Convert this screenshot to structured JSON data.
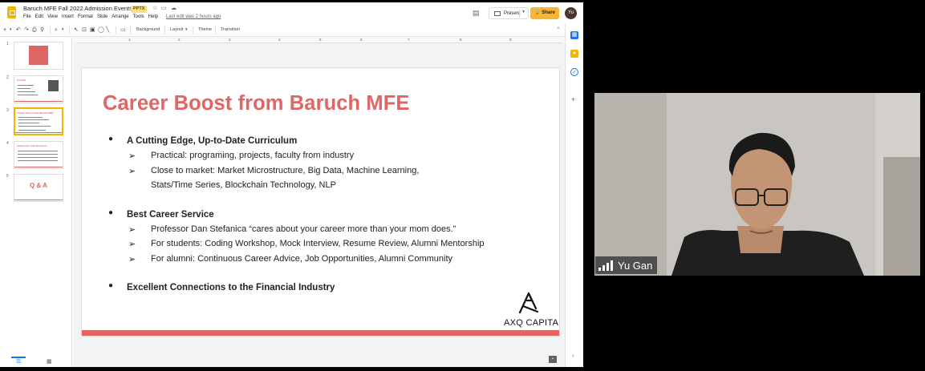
{
  "window": {
    "doc_title": "Baruch MFE Fall 2022 Admission Events",
    "format_badge": "PPTX",
    "menu": [
      "File",
      "Edit",
      "View",
      "Insert",
      "Format",
      "Slide",
      "Arrange",
      "Tools",
      "Help"
    ],
    "last_edit": "Last edit was 2 hours ago",
    "present_label": "Present",
    "share_label": "Share",
    "avatar_initials": "Yu"
  },
  "toolbar": {
    "background_label": "Background",
    "layout_label": "Layout",
    "theme_label": "Theme",
    "transition_label": "Transition"
  },
  "ruler": [
    "1",
    "2",
    "3",
    "4",
    "5",
    "6",
    "7",
    "8",
    "9"
  ],
  "filmstrip": {
    "slides": [
      {
        "number": "1",
        "title": "",
        "active": false
      },
      {
        "number": "2",
        "title": "Content",
        "active": false
      },
      {
        "number": "3",
        "title": "Career Boost from Baruch MFE",
        "active": true
      },
      {
        "number": "4",
        "title": "Admission / Info Sessions",
        "active": false
      },
      {
        "number": "5",
        "title": "Q & A",
        "active": false
      }
    ]
  },
  "slide": {
    "title": "Career Boost from Baruch MFE",
    "sections": [
      {
        "heading": "A  Cutting Edge, Up-to-Date Curriculum",
        "items": [
          "Practical: programing, projects, faculty from industry",
          "Close to market: Market Microstructure, Big Data, Machine Learning,",
          "Stats/Time Series, Blockchain Technology,  NLP"
        ]
      },
      {
        "heading": "Best Career Service",
        "items": [
          "Professor Dan Stefanica “cares about your career more than your mom does.”",
          "For students: Coding Workshop, Mock Interview, Resume Review,  Alumni Mentorship",
          "For alumni: Continuous Career Advice, Job Opportunities, Alumni Community"
        ]
      },
      {
        "heading": "Excellent Connections to the Financial Industry",
        "items": []
      }
    ],
    "logo_text": "AXQ CAPITAL",
    "accent_color": "#e06666"
  },
  "video": {
    "participant_name": "Yu Gan"
  }
}
